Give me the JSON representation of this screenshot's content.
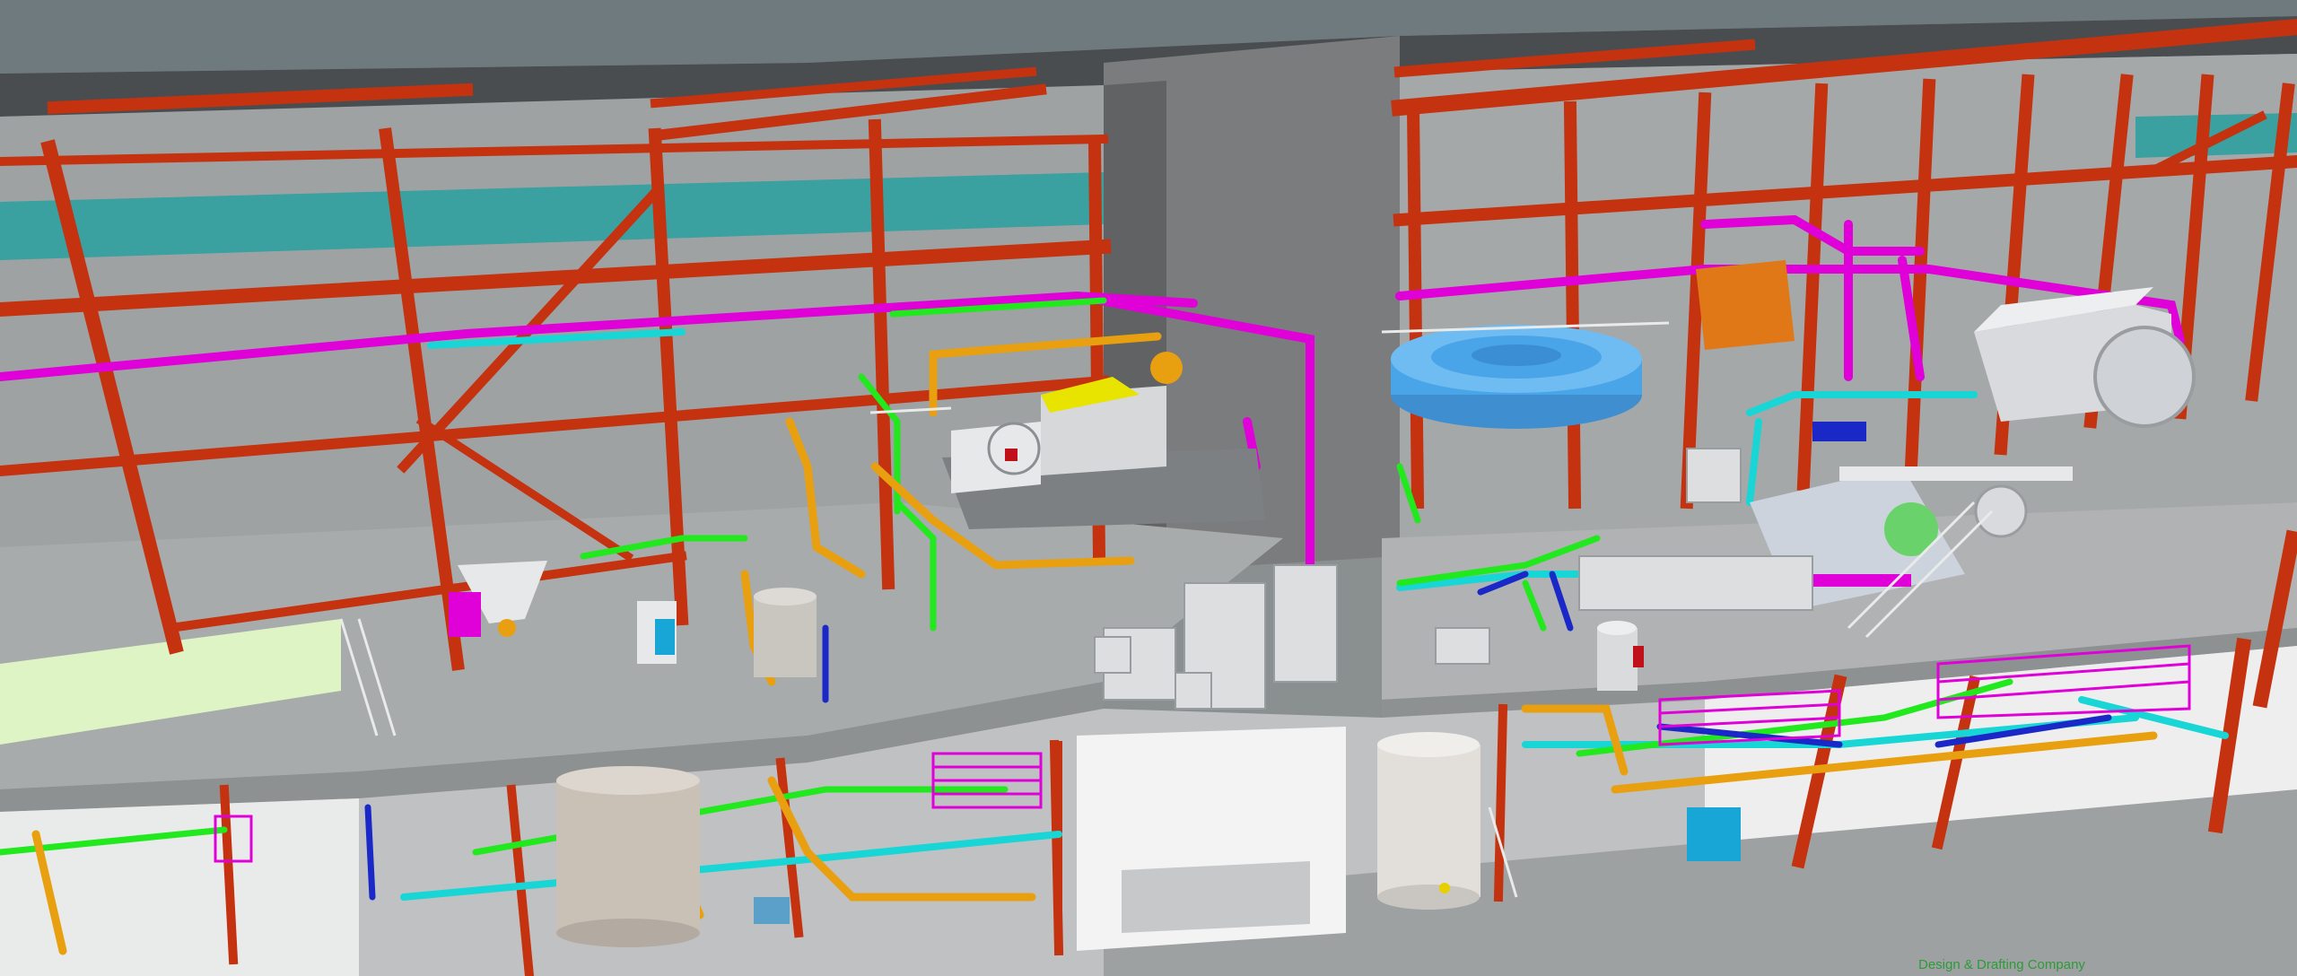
{
  "scene": {
    "watermark": "Design & Drafting Company",
    "colors": {
      "ceiling": "#6f7a7f",
      "wall": "#9ea2a3",
      "floor": "#a8abac",
      "steel": "#c4320f",
      "pipe_magenta": "#e000d8",
      "pipe_green": "#22e81e",
      "pipe_orange": "#e8a010",
      "pipe_cyan": "#18d6d6",
      "pipe_blue": "#1a28c8",
      "vat_blue": "#4aa4e8",
      "equipment_white": "#e6e8ea",
      "window_teal": "#3aa0a0",
      "accent_yellow": "#e8e400"
    },
    "equipment": [
      {
        "name": "blower-unit",
        "icon": "blower-icon"
      },
      {
        "name": "clarifier-tank",
        "icon": "round-tank-icon"
      },
      {
        "name": "paper-machine",
        "icon": "roller-machine-icon"
      },
      {
        "name": "storage-tank-lower-left",
        "icon": "vertical-tank-icon"
      },
      {
        "name": "storage-tank-lower-center",
        "icon": "vertical-tank-icon"
      },
      {
        "name": "pressure-vessel",
        "icon": "vertical-tank-icon"
      },
      {
        "name": "hopper",
        "icon": "hopper-icon"
      },
      {
        "name": "motor-pumps",
        "icon": "pump-icon"
      }
    ]
  }
}
